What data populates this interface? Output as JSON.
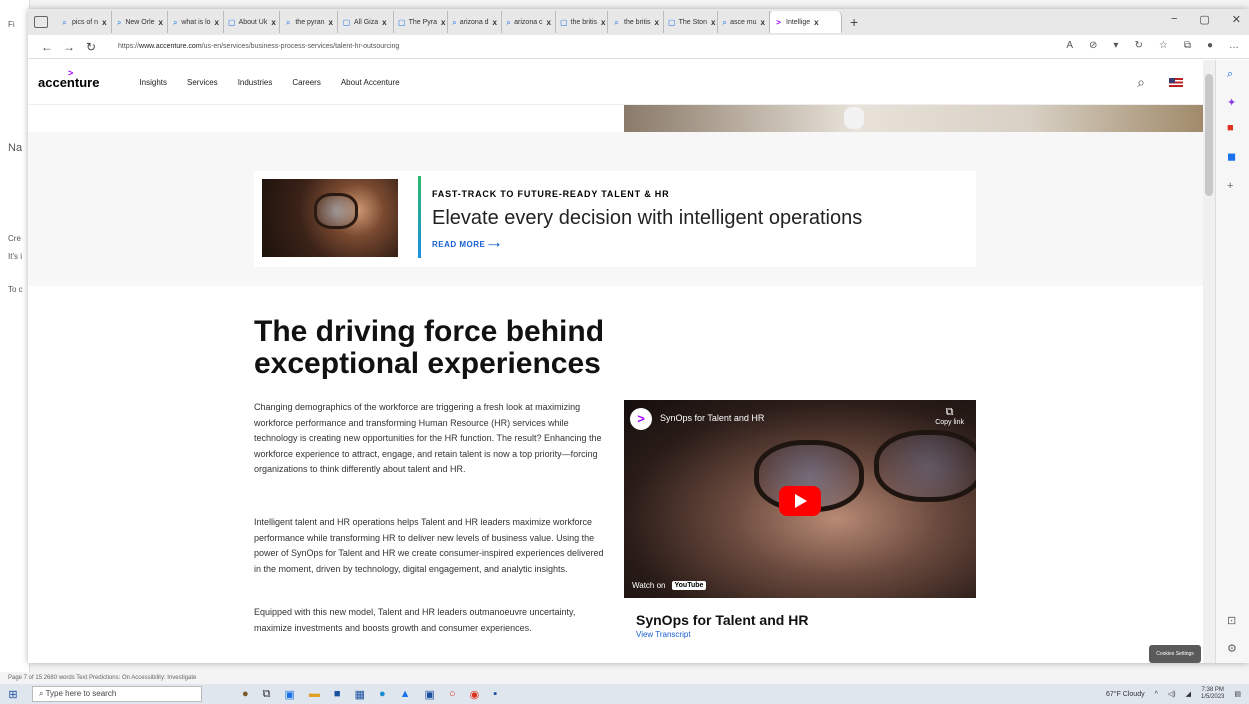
{
  "word": {
    "status": "Page 7 of 15   2680 words   Text Predictions: On   Accessibility: Investigate",
    "side_labels": [
      "Fi",
      "Na",
      "Cre",
      "It's i",
      "To c"
    ]
  },
  "browser": {
    "tabs": [
      {
        "label": "pics of n",
        "icon": "search-icon"
      },
      {
        "label": "New Orle",
        "icon": "search-icon"
      },
      {
        "label": "what is lo",
        "icon": "search-icon"
      },
      {
        "label": "About Uk",
        "icon": "page-icon"
      },
      {
        "label": "the pyran",
        "icon": "search-icon"
      },
      {
        "label": "All Giza",
        "icon": "wiki-icon"
      },
      {
        "label": "The Pyra",
        "icon": "page-icon"
      },
      {
        "label": "arizona d",
        "icon": "search-icon"
      },
      {
        "label": "arizona c",
        "icon": "search-icon"
      },
      {
        "label": "the britis",
        "icon": "page-icon"
      },
      {
        "label": "the britis",
        "icon": "search-icon"
      },
      {
        "label": "The Ston",
        "icon": "page-icon"
      },
      {
        "label": "asce mu",
        "icon": "search-icon"
      },
      {
        "label": "Intellige",
        "icon": "accenture-icon",
        "active": true
      }
    ],
    "url_prefix": "https://",
    "url_host": "www.accenture.com",
    "url_path": "/us-en/services/business-process-services/talent-hr-outsourcing"
  },
  "site": {
    "logo": "accenture",
    "nav": [
      "Insights",
      "Services",
      "Industries",
      "Careers",
      "About Accenture"
    ],
    "promo": {
      "eyebrow": "FAST-TRACK TO FUTURE-READY TALENT & HR",
      "title": "Elevate every decision with intelligent operations",
      "link": "READ MORE"
    },
    "headline": "The driving force behind exceptional experiences",
    "paragraphs": [
      "Changing demographics of the workforce are triggering a fresh look at maximizing workforce performance and transforming Human Resource (HR) services while technology is creating new opportunities for the HR function. The result? Enhancing the workforce experience to attract, engage, and retain talent is now a top priority—forcing organizations to think differently about talent and HR.",
      "Intelligent talent and HR operations helps Talent and HR leaders maximize workforce performance while transforming HR to deliver new levels of business value. Using the power of SynOps for Talent and HR we create consumer-inspired experiences delivered in the moment, driven by technology, digital engagement, and analytic insights.",
      "Equipped with this new model, Talent and HR leaders outmanoeuvre uncertainty, maximize investments and boosts growth and consumer experiences."
    ],
    "video": {
      "title": "SynOps for Talent and HR",
      "copy_link": "Copy link",
      "watch_on": "Watch on",
      "youtube": "YouTube"
    },
    "video_caption": "SynOps for Talent and HR",
    "transcript_link": "View Transcript",
    "cookie_button": "Cookies Settings"
  },
  "taskbar": {
    "search_placeholder": "Type here to search",
    "weather": "67°F  Cloudy",
    "time": "7:38 PM",
    "date": "1/5/2023"
  }
}
